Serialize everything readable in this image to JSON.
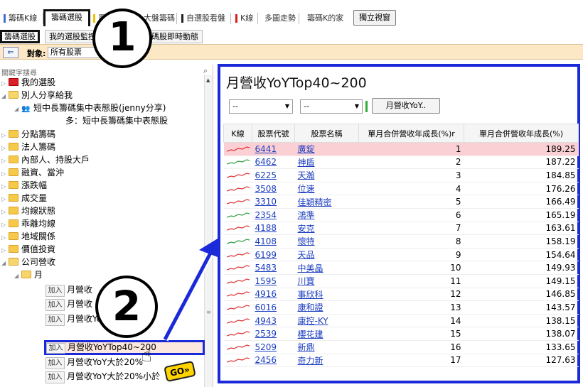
{
  "top_tabs": [
    {
      "label": "籌碼K線",
      "bar_color": "#3f6fd6"
    },
    {
      "label": "籌碼選股",
      "selected": true
    },
    {
      "label": "買",
      "bar_color": "#f5c400"
    },
    {
      "label": "大盤籌碼",
      "bar_color": "#b44bd6"
    },
    {
      "label": "自選股看盤",
      "bar_color": "#222222"
    },
    {
      "label": "K線",
      "bar_color": "#d82020"
    },
    {
      "label": "多圖走勢"
    },
    {
      "label": "籌碼K的家"
    }
  ],
  "independent_window_button": "獨立視窗",
  "sub_tabs": [
    {
      "label": "籌碼選股",
      "selected": true
    },
    {
      "label": "我的選股監控"
    },
    {
      "label": "籌碼股即時動態"
    }
  ],
  "filter": {
    "label": "對象:",
    "value": "所有股票"
  },
  "callouts": {
    "one": "①",
    "two": "②"
  },
  "left": {
    "search_placeholder": "關鍵字搜尋",
    "tree": [
      {
        "label": "我的選股",
        "icon": "red-folder"
      },
      {
        "label": "別人分享給我",
        "icon": "open-folder"
      },
      {
        "label": "短中長籌碼集中表態股(jenny分享)",
        "icon": "people-icon"
      },
      {
        "label": "多：短中長籌碼集中表態股"
      },
      {
        "label": "分點籌碼"
      },
      {
        "label": "法人籌碼"
      },
      {
        "label": "內部人、持股大戶"
      },
      {
        "label": "融資、當沖"
      },
      {
        "label": "漲跌幅"
      },
      {
        "label": "成交量"
      },
      {
        "label": "均線狀態"
      },
      {
        "label": "乖離均線"
      },
      {
        "label": "地域關係"
      },
      {
        "label": "價值投資"
      },
      {
        "label": "公司營收"
      },
      {
        "label": "月"
      }
    ],
    "add_label": "加入",
    "add_items": [
      "月營收",
      "月營收",
      "月營收YoYTop300",
      "月營收YoYTop40~200",
      "月營收YoY大於20%",
      "月營收YoY大於20%小於"
    ],
    "go_label": "GO»"
  },
  "right": {
    "title": "月營收YoYTop40~200",
    "select1": "--",
    "select2": "--",
    "yoy_button": "月營收YoY..",
    "headers": [
      "K線",
      "股票代號",
      "股票名稱",
      "單月合併營收年成長(%)r",
      "單月合併營收年成長(%)"
    ],
    "rows": [
      {
        "code": "6441",
        "name": "廣錠",
        "rank": "1",
        "pct": "189.25"
      },
      {
        "code": "6462",
        "name": "神盾",
        "rank": "2",
        "pct": "187.22"
      },
      {
        "code": "6225",
        "name": "天瀚",
        "rank": "3",
        "pct": "184.85"
      },
      {
        "code": "3508",
        "name": "位速",
        "rank": "4",
        "pct": "176.26"
      },
      {
        "code": "3310",
        "name": "佳穎精密",
        "rank": "5",
        "pct": "166.49"
      },
      {
        "code": "2354",
        "name": "鴻準",
        "rank": "6",
        "pct": "165.19"
      },
      {
        "code": "4188",
        "name": "安克",
        "rank": "7",
        "pct": "163.61"
      },
      {
        "code": "4108",
        "name": "懷特",
        "rank": "8",
        "pct": "158.19"
      },
      {
        "code": "6199",
        "name": "天品",
        "rank": "9",
        "pct": "154.64"
      },
      {
        "code": "5483",
        "name": "中美晶",
        "rank": "10",
        "pct": "149.93"
      },
      {
        "code": "1595",
        "name": "川寶",
        "rank": "11",
        "pct": "149.15"
      },
      {
        "code": "4916",
        "name": "事欣科",
        "rank": "12",
        "pct": "146.85"
      },
      {
        "code": "6016",
        "name": "康和證",
        "rank": "13",
        "pct": "143.57"
      },
      {
        "code": "4943",
        "name": "康控-KY",
        "rank": "14",
        "pct": "138.15"
      },
      {
        "code": "2539",
        "name": "櫻花建",
        "rank": "15",
        "pct": "138.07"
      },
      {
        "code": "5209",
        "name": "新鼎",
        "rank": "16",
        "pct": "133.65"
      },
      {
        "code": "2456",
        "name": "奇力新",
        "rank": "17",
        "pct": "127.63"
      }
    ]
  },
  "colors": {
    "highlight_blue": "#1a2ad8",
    "first_row": "#fbd0d4",
    "filter_bar": "#fde8c6"
  }
}
